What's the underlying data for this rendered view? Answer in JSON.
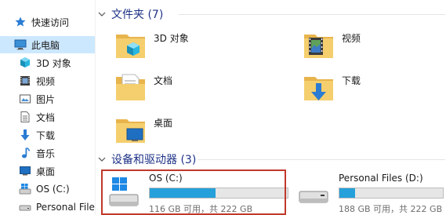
{
  "nav": {
    "items": [
      {
        "label": "快速访问",
        "icon": "star-icon"
      },
      {
        "label": "此电脑",
        "icon": "computer-icon"
      },
      {
        "label": "3D 对象",
        "icon": "3d-objects-icon"
      },
      {
        "label": "视频",
        "icon": "video-icon"
      },
      {
        "label": "图片",
        "icon": "pictures-icon"
      },
      {
        "label": "文档",
        "icon": "documents-icon"
      },
      {
        "label": "下载",
        "icon": "download-icon"
      },
      {
        "label": "音乐",
        "icon": "music-icon"
      },
      {
        "label": "桌面",
        "icon": "desktop-icon"
      },
      {
        "label": "OS (C:)",
        "icon": "windows-drive-icon"
      },
      {
        "label": "Personal Files",
        "icon": "drive-icon"
      }
    ]
  },
  "folders_section": {
    "title": "文件夹 (7)",
    "items": [
      {
        "name": "3D 对象",
        "icon": "3d-objects-folder-icon"
      },
      {
        "name": "视频",
        "icon": "video-folder-icon"
      },
      {
        "name": "文档",
        "icon": "documents-folder-icon"
      },
      {
        "name": "下载",
        "icon": "download-folder-icon"
      },
      {
        "name": "桌面",
        "icon": "desktop-folder-icon"
      }
    ]
  },
  "drives_section": {
    "title": "设备和驱动器 (3)",
    "drives": [
      {
        "name": "OS (C:)",
        "free_text": "116 GB 可用，共 222 GB",
        "used_fraction": 0.48,
        "icon": "windows-drive-icon"
      },
      {
        "name": "Personal Files (D:)",
        "free_text": "188 GB 可用，共 222 GB",
        "used_fraction": 0.15,
        "icon": "drive-icon"
      }
    ]
  },
  "colors": {
    "accent": "#26a0da",
    "selected_nav": "#cce8ff",
    "section_title": "#1e3287",
    "highlight_box": "#c0392b",
    "folder": "#f3c764"
  }
}
